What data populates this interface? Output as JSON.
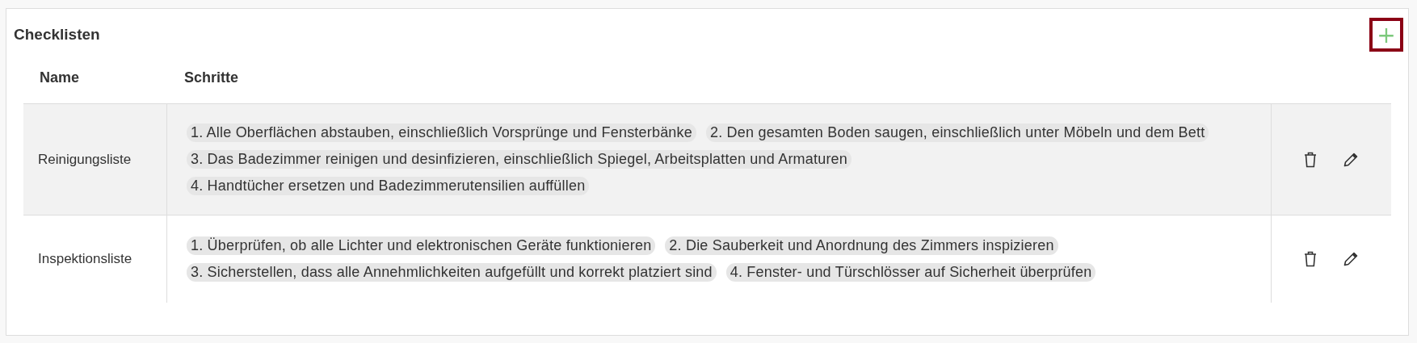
{
  "title": "Checklisten",
  "add_button": {
    "label": "+",
    "focused": true
  },
  "table": {
    "columns": [
      "Name",
      "Schritte"
    ],
    "rows": [
      {
        "name": "Reinigungsliste",
        "highlighted": true,
        "steps": [
          "1. Alle Oberflächen abstauben, einschließlich Vorsprünge und Fensterbänke",
          "2. Den gesamten Boden saugen, einschließlich unter Möbeln und dem Bett",
          "3. Das Badezimmer reinigen und desinfizieren, einschließlich Spiegel, Arbeitsplatten und Armaturen",
          "4. Handtücher ersetzen und Badezimmerutensilien auffüllen"
        ]
      },
      {
        "name": "Inspektionsliste",
        "highlighted": false,
        "steps": [
          "1. Überprüfen, ob alle Lichter und elektronischen Geräte funktionieren",
          "2. Die Sauberkeit und Anordnung des Zimmers inspizieren",
          "3. Sicherstellen, dass alle Annehmlichkeiten aufgefüllt und korrekt platziert sind",
          "4. Fenster- und Türschlösser auf Sicherheit überprüfen"
        ]
      }
    ]
  }
}
